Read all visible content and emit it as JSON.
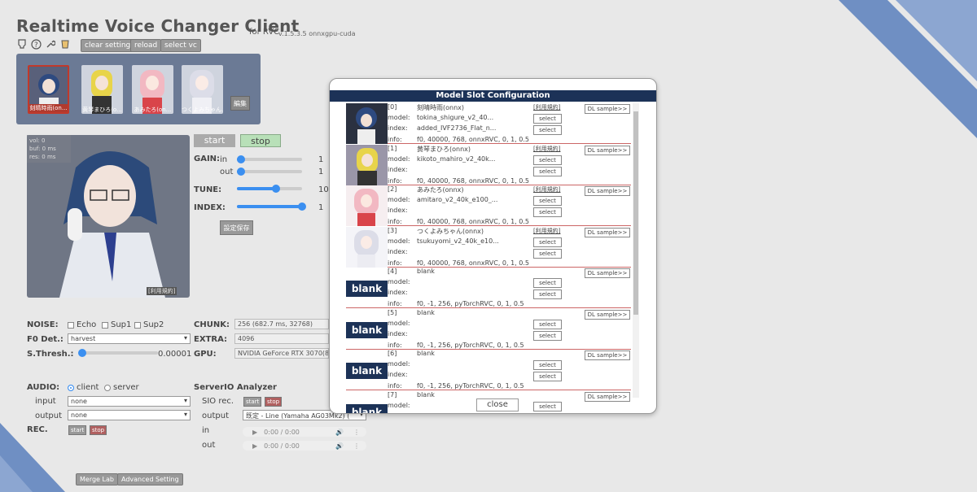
{
  "header": {
    "title": "Realtime Voice Changer Client",
    "subtitle": "for RVC",
    "version": "v.1.5.3.5  onnxgpu-cuda",
    "buttons": {
      "clear": "clear setting",
      "reload": "reload",
      "select_vc": "select vc"
    }
  },
  "model_slots_panel": {
    "thumbs": [
      "刻晴時雨(on...",
      "黄琴まひろ(o...",
      "あみたろ(on...",
      "つくよみちゃん..."
    ],
    "edit_label": "編集"
  },
  "character": {
    "vol": "vol: 0",
    "buf": "buf: 0 ms",
    "res": "res: 0 ms",
    "terms": "[利用規約]"
  },
  "controls": {
    "start": "start",
    "stop": "stop",
    "gain_label": "GAIN:",
    "in_label": "in",
    "out_label": "out",
    "in_value": "1",
    "out_value": "1",
    "tune_label": "TUNE:",
    "tune_value": "10",
    "index_label": "INDEX:",
    "index_value": "1",
    "save": "設定保存",
    "levels": {
      "in": 0.05,
      "out": 0.05,
      "tune": 0.6,
      "index": 1.0
    }
  },
  "settings": {
    "noise_label": "NOISE:",
    "echo": "Echo",
    "sup1": "Sup1",
    "sup2": "Sup2",
    "f0_label": "F0 Det.:",
    "f0_value": "harvest",
    "sthresh_label": "S.Thresh.:",
    "sthresh_value": "0.00001",
    "chunk_label": "CHUNK:",
    "chunk_value": "256 (682.7 ms, 32768)",
    "extra_label": "EXTRA:",
    "extra_value": "4096",
    "gpu_label": "GPU:",
    "gpu_value": "NVIDIA GeForce RTX 3070(8"
  },
  "audio": {
    "label": "AUDIO:",
    "client": "client",
    "server": "server",
    "input_label": "input",
    "input_value": "none",
    "output_label": "output",
    "output_value": "none",
    "rec_label": "REC.",
    "start": "start",
    "stop": "stop"
  },
  "analyzer": {
    "title": "ServerIO Analyzer",
    "sio_label": "SIO rec.",
    "start": "start",
    "stop": "stop",
    "output_label": "output",
    "output_value": "既定 - Line (Yamaha AG03Mk2) (",
    "in_label": "in",
    "out_label": "out",
    "in_time": "0:00 / 0:00",
    "out_time": "0:00 / 0:00"
  },
  "footer": {
    "merge": "Merge Lab",
    "advanced": "Advanced Setting"
  },
  "modal": {
    "title": "Model Slot Configuration",
    "labels": {
      "model": "model:",
      "index": "index:",
      "info": "info:",
      "select": "select",
      "terms": "[利用規約]",
      "dl": "DL sample>>",
      "blank": "blank"
    },
    "slots": [
      {
        "id": "[0]",
        "name": "刻晴時雨(onnx)",
        "model": "tokina_shigure_v2_40...",
        "index": "added_IVF2736_Flat_n...",
        "info": "f0, 40000, 768, onnxRVC, 0, 1, 0.5"
      },
      {
        "id": "[1]",
        "name": "黄琴まひろ(onnx)",
        "model": "kikoto_mahiro_v2_40k...",
        "index": "",
        "info": "f0, 40000, 768, onnxRVC, 0, 1, 0.5"
      },
      {
        "id": "[2]",
        "name": "あみたろ(onnx)",
        "model": "amitaro_v2_40k_e100_...",
        "index": "",
        "info": "f0, 40000, 768, onnxRVC, 0, 1, 0.5"
      },
      {
        "id": "[3]",
        "name": "つくよみちゃん(onnx)",
        "model": "tsukuyomi_v2_40k_e10...",
        "index": "",
        "info": "f0, 40000, 768, onnxRVC, 0, 1, 0.5"
      },
      {
        "id": "[4]",
        "name": "blank",
        "model": "",
        "index": "",
        "info": "f0, -1, 256, pyTorchRVC, 0, 1, 0.5"
      },
      {
        "id": "[5]",
        "name": "blank",
        "model": "",
        "index": "",
        "info": "f0, -1, 256, pyTorchRVC, 0, 1, 0.5"
      },
      {
        "id": "[6]",
        "name": "blank",
        "model": "",
        "index": "",
        "info": "f0, -1, 256, pyTorchRVC, 0, 1, 0.5"
      },
      {
        "id": "[7]",
        "name": "blank",
        "model": "",
        "index": "",
        "info": ""
      }
    ],
    "close": "close"
  }
}
